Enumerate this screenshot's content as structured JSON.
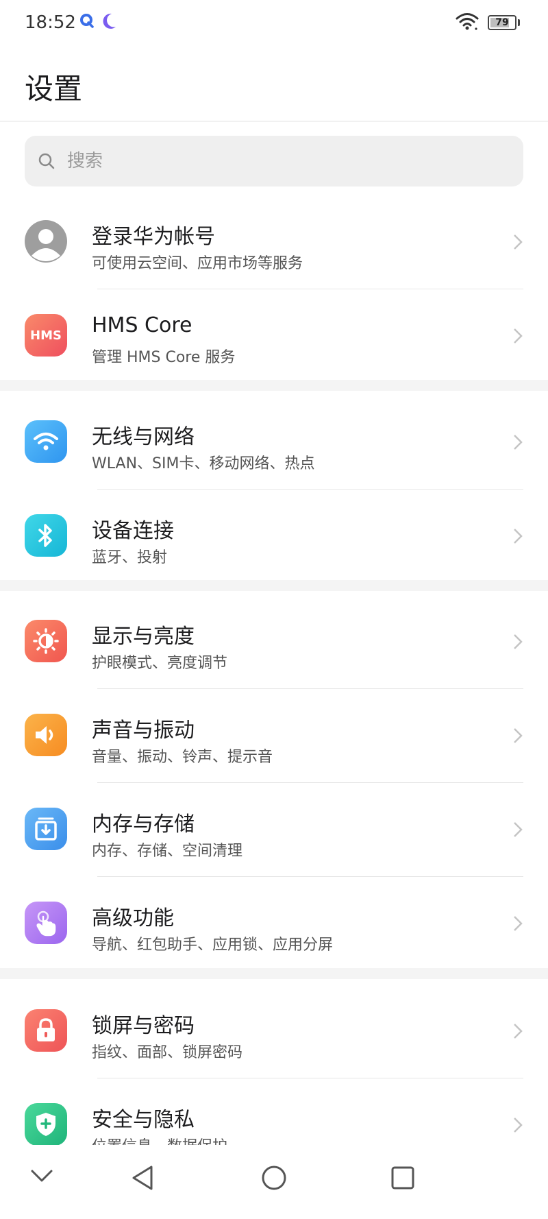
{
  "status_bar": {
    "time": "18:52",
    "battery": "79",
    "battery_level_percent": 79,
    "icons": [
      "q-notification-icon",
      "moon-icon",
      "wifi-icon",
      "battery-icon"
    ]
  },
  "page_title": "设置",
  "search": {
    "placeholder": "搜索"
  },
  "items": [
    {
      "title": "登录华为帐号",
      "subtitle": "可使用云空间、应用市场等服务",
      "icon": "avatar-icon",
      "color": "#9e9e9e"
    },
    {
      "title": "HMS Core",
      "subtitle": "管理 HMS Core 服务",
      "icon_text": "HMS",
      "icon": "hms-icon",
      "color": "#f2625b"
    },
    {
      "title": "无线与网络",
      "subtitle": "WLAN、SIM卡、移动网络、热点",
      "icon": "wifi-icon",
      "color": "#3aa8f5"
    },
    {
      "title": "设备连接",
      "subtitle": "蓝牙、投射",
      "icon": "bluetooth-icon",
      "color": "#22c4de"
    },
    {
      "title": "显示与亮度",
      "subtitle": "护眼模式、亮度调节",
      "icon": "brightness-icon",
      "color": "#f5705e"
    },
    {
      "title": "声音与振动",
      "subtitle": "音量、振动、铃声、提示音",
      "icon": "speaker-icon",
      "color": "#f9a134"
    },
    {
      "title": "内存与存储",
      "subtitle": "内存、存储、空间清理",
      "icon": "storage-icon",
      "color": "#4aa2ef"
    },
    {
      "title": "高级功能",
      "subtitle": "导航、红包助手、应用锁、应用分屏",
      "icon": "gesture-icon",
      "color": "#b07bf2"
    },
    {
      "title": "锁屏与密码",
      "subtitle": "指纹、面部、锁屏密码",
      "icon": "lock-icon",
      "color": "#f26a64"
    },
    {
      "title": "安全与隐私",
      "subtitle": "位置信息、数据保护",
      "icon": "shield-icon",
      "color": "#2fc48a"
    }
  ],
  "nav": [
    "back-chevron-icon",
    "back-triangle-icon",
    "home-circle-icon",
    "recents-square-icon"
  ]
}
